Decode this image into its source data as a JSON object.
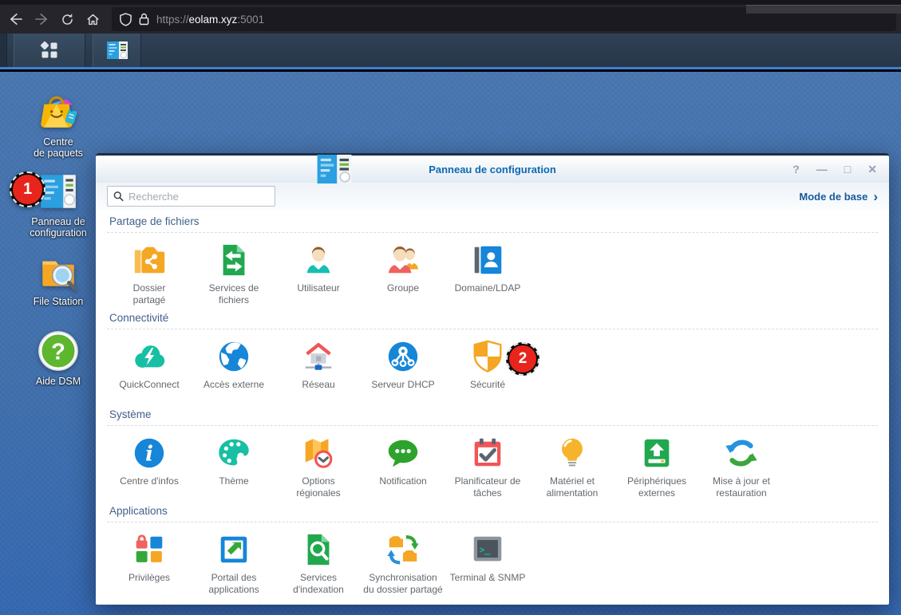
{
  "browser": {
    "url_prefix": "https://",
    "url_host": "eolam.xyz",
    "url_port": ":5001"
  },
  "taskbar": {
    "buttons": [
      {
        "name": "main-menu",
        "icon": "main-menu"
      },
      {
        "name": "control-panel-app",
        "icon": "cp-mini"
      }
    ]
  },
  "desktop": {
    "icons": [
      {
        "icon": "package-center",
        "lines": [
          "Centre",
          "de paquets"
        ]
      },
      {
        "icon": "control-panel",
        "lines": [
          "Panneau de",
          "configuration"
        ],
        "badge": "1"
      },
      {
        "icon": "file-station",
        "lines": [
          "File Station"
        ]
      },
      {
        "icon": "dsm-help",
        "lines": [
          "Aide DSM"
        ]
      }
    ]
  },
  "window": {
    "icon": "cp-mini",
    "title": "Panneau de configuration",
    "controls": [
      {
        "name": "help",
        "glyph": "?"
      },
      {
        "name": "minimize",
        "glyph": "—"
      },
      {
        "name": "maximize",
        "glyph": "□"
      },
      {
        "name": "close",
        "glyph": "✕"
      }
    ],
    "search_placeholder": "Recherche",
    "mode_link": "Mode de base",
    "mode_chevron": "›",
    "sections": [
      {
        "title": "Partage de fichiers",
        "items": [
          {
            "icon": "shared-folder",
            "lines": [
              "Dossier",
              "partagé"
            ]
          },
          {
            "icon": "file-services",
            "lines": [
              "Services de",
              "fichiers"
            ]
          },
          {
            "icon": "user",
            "lines": [
              "Utilisateur"
            ]
          },
          {
            "icon": "group",
            "lines": [
              "Groupe"
            ]
          },
          {
            "icon": "domain-ldap",
            "lines": [
              "Domaine/LDAP"
            ]
          }
        ]
      },
      {
        "title": "Connectivité",
        "items": [
          {
            "icon": "quickconnect",
            "lines": [
              "QuickConnect"
            ]
          },
          {
            "icon": "external-access",
            "lines": [
              "Accès externe"
            ]
          },
          {
            "icon": "network",
            "lines": [
              "Réseau"
            ]
          },
          {
            "icon": "dhcp-server",
            "lines": [
              "Serveur DHCP"
            ]
          },
          {
            "icon": "security",
            "lines": [
              "Sécurité"
            ],
            "badge": "2"
          }
        ]
      },
      {
        "title": "Système",
        "items": [
          {
            "icon": "info-center",
            "lines": [
              "Centre d'infos"
            ]
          },
          {
            "icon": "theme",
            "lines": [
              "Thème"
            ]
          },
          {
            "icon": "regional-options",
            "lines": [
              "Options",
              "régionales"
            ]
          },
          {
            "icon": "notification",
            "lines": [
              "Notification"
            ]
          },
          {
            "icon": "task-scheduler",
            "lines": [
              "Planificateur de",
              "tâches"
            ]
          },
          {
            "icon": "hardware-power",
            "lines": [
              "Matériel et",
              "alimentation"
            ]
          },
          {
            "icon": "external-devices",
            "lines": [
              "Périphériques",
              "externes"
            ]
          },
          {
            "icon": "update-restore",
            "lines": [
              "Mise à jour et",
              "restauration"
            ]
          }
        ]
      },
      {
        "title": "Applications",
        "items": [
          {
            "icon": "privileges",
            "lines": [
              "Privilèges"
            ]
          },
          {
            "icon": "app-portal",
            "lines": [
              "Portail des",
              "applications"
            ]
          },
          {
            "icon": "indexing-services",
            "lines": [
              "Services",
              "d'indexation"
            ]
          },
          {
            "icon": "shared-folder-sync",
            "lines": [
              "Synchronisation",
              "du dossier partagé"
            ]
          },
          {
            "icon": "terminal-snmp",
            "lines": [
              "Terminal & SNMP"
            ]
          }
        ]
      }
    ]
  },
  "annotations": {
    "markers": [
      "1",
      "2"
    ],
    "marker_color": "#e8251c"
  },
  "colors": {
    "accent_blue": "#0c6ab2",
    "desktop_blue": "#4472ae",
    "taskbar_navy": "#2e4052",
    "badge_red": "#e8251c",
    "section_title": "#40618c",
    "label_gray": "#63686e"
  }
}
